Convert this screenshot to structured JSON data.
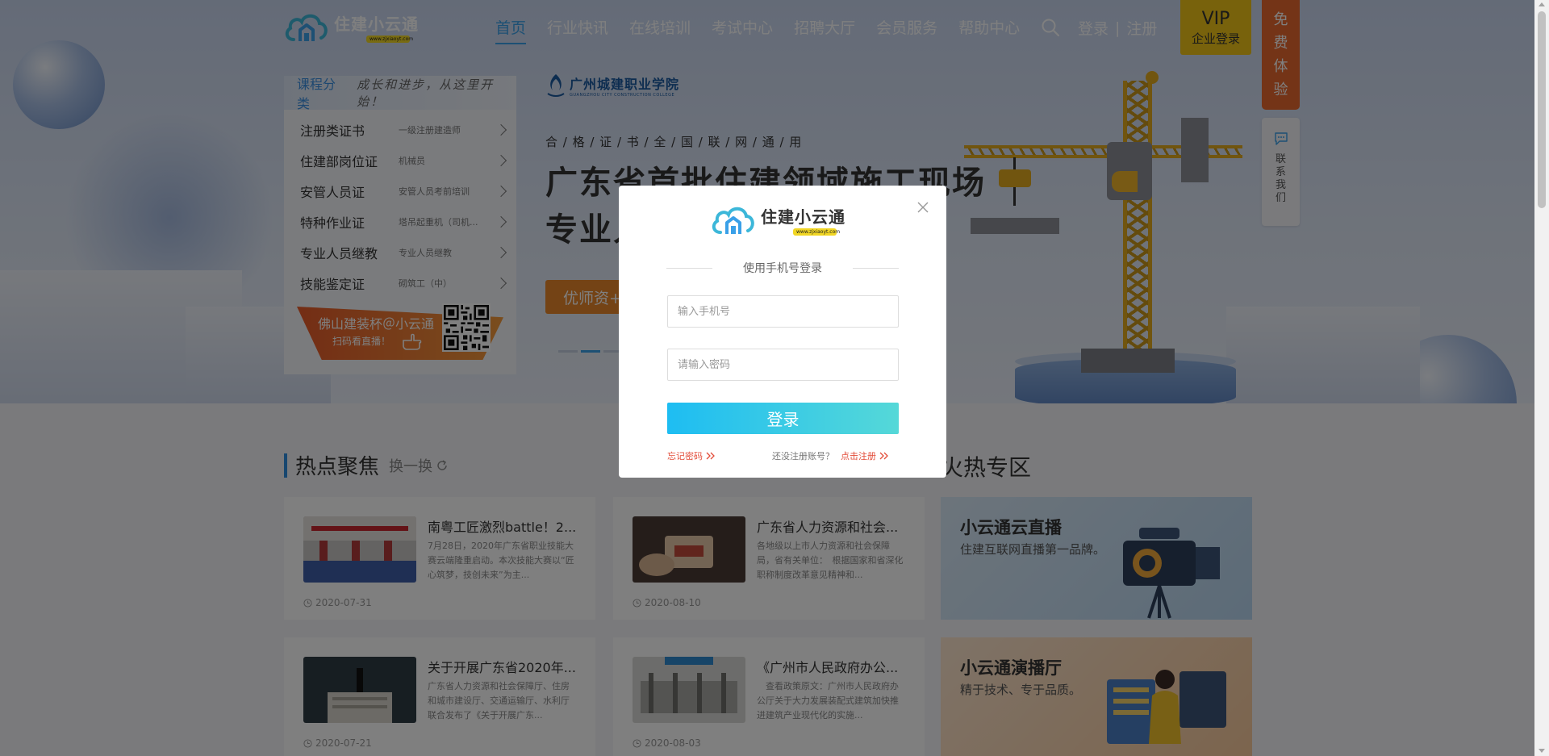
{
  "header": {
    "logo_name": "住建小云通",
    "logo_url": "www.zjxiaoyt.com",
    "nav": [
      "首页",
      "行业快讯",
      "在线培训",
      "考试中心",
      "招聘大厅",
      "会员服务",
      "帮助中心"
    ],
    "login": "登录",
    "separator": "|",
    "register": "注册",
    "vip": "VIP",
    "enterprise_login": "企业登录"
  },
  "side": {
    "free_trial": [
      "免",
      "费",
      "体",
      "验"
    ],
    "contact": [
      "联",
      "系",
      "我",
      "们"
    ]
  },
  "categories": {
    "title": "课程分类",
    "slogan": "成长和进步，从这里开始！",
    "items": [
      {
        "main": "注册类证书",
        "sub": "一级注册建造师"
      },
      {
        "main": "住建部岗位证",
        "sub": "机械员"
      },
      {
        "main": "安管人员证",
        "sub": "安管人员考前培训"
      },
      {
        "main": "特种作业证",
        "sub": "塔吊起重机（司机..."
      },
      {
        "main": "专业人员继教",
        "sub": "专业人员继教"
      },
      {
        "main": "技能鉴定证",
        "sub": "砌筑工（中）"
      }
    ],
    "promo_title": "佛山建装杯＠小云通",
    "promo_sub": "扫码看直播！"
  },
  "banner": {
    "college_name": "广州城建职业学院",
    "college_en": "GUANGZHOU CITY CONSTRUCTION COLLEGE",
    "cert_line": "合 / 格 / 证 / 书 / 全 / 国 / 联 / 网 / 通 / 用",
    "title": "广东省首批住建领域施工现场专业人员",
    "button": "优师资+"
  },
  "hot": {
    "title": "热点聚焦",
    "refresh": "换一换",
    "right_title": "火热专区",
    "news": [
      {
        "title": "南粤工匠激烈battle！2...",
        "desc": "7月28日，2020年广东省职业技能大赛云端隆重启动。本次技能大赛以“匠心筑梦，技创未来”为主...",
        "date": "2020-07-31"
      },
      {
        "title": "广东省人力资源和社会...",
        "desc": "各地级以上市人力资源和社会保障局，省有关单位：　根据国家和省深化职称制度改革意见精神和...",
        "date": "2020-08-10"
      },
      {
        "title": "关于开展广东省2020年...",
        "desc": "广东省人力资源和社会保障厅、住房和城市建设厅、交通运输厅、水利厅联合发布了《关于开展广东...",
        "date": "2020-07-21"
      },
      {
        "title": "《广州市人民政府办公...",
        "desc": "　查看政策原文：广州市人民政府办公厅关于大力发展装配式建筑加快推进建筑产业现代化的实施...",
        "date": "2020-08-03"
      }
    ],
    "features": [
      {
        "title": "小云通云直播",
        "sub": "住建互联网直播第一品牌。"
      },
      {
        "title": "小云通演播厅",
        "sub": "精于技术、专于品质。"
      }
    ]
  },
  "modal": {
    "logo_name": "住建小云通",
    "logo_url": "www.zjxiaoyt.com",
    "subtitle": "使用手机号登录",
    "phone_placeholder": "输入手机号",
    "password_placeholder": "请输入密码",
    "login_button": "登录",
    "forgot": "忘记密码",
    "no_account": "还没注册账号？",
    "register_link": "点击注册"
  },
  "colors": {
    "accent": "#3aa0e8",
    "vip": "#f0c419",
    "free_trial": "#e8692e",
    "link_red": "#e34d3a"
  }
}
